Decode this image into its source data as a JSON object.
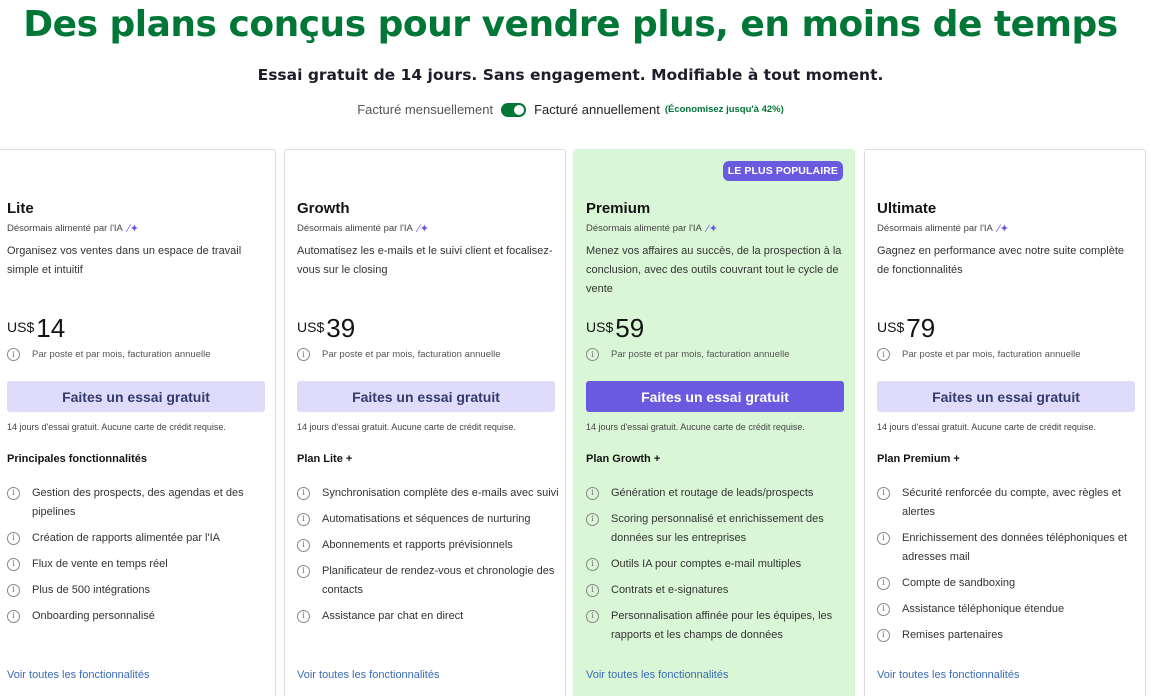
{
  "header": {
    "title": "Des plans conçus pour vendre plus, en moins de temps",
    "subtitle": "Essai gratuit de 14 jours. Sans engagement. Modifiable à tout moment."
  },
  "billing": {
    "monthly_label": "Facturé mensuellement",
    "annual_label": "Facturé annuellement",
    "savings": "(Économisez jusqu'à 42%)",
    "selected": "annual"
  },
  "plans": [
    {
      "name": "Lite",
      "ai_label": "Désormais alimenté par l'IA",
      "description": "Organisez vos ventes dans un espace de travail simple et intuitif",
      "currency": "US$",
      "price": "14",
      "price_note": "Par poste et par mois, facturation annuelle",
      "cta": "Faites un essai gratuit",
      "trial_note": "14 jours d'essai gratuit. Aucune carte de crédit requise.",
      "features_heading": "Principales fonctionnalités",
      "features": [
        "Gestion des prospects, des agendas et des pipelines",
        "Création de rapports alimentée par l'IA",
        "Flux de vente en temps réel",
        "Plus de 500 intégrations",
        "Onboarding personnalisé"
      ],
      "see_all": "Voir toutes les fonctionnalités"
    },
    {
      "name": "Growth",
      "ai_label": "Désormais alimenté par l'IA",
      "description": "Automatisez les e-mails et le suivi client et focalisez-vous sur le closing",
      "currency": "US$",
      "price": "39",
      "price_note": "Par poste et par mois, facturation annuelle",
      "cta": "Faites un essai gratuit",
      "trial_note": "14 jours d'essai gratuit. Aucune carte de crédit requise.",
      "features_heading": "Plan Lite +",
      "features": [
        "Synchronisation complète des e-mails avec suivi",
        "Automatisations et séquences de nurturing",
        "Abonnements et rapports prévisionnels",
        "Planificateur de rendez-vous et chronologie des contacts",
        "Assistance par chat en direct"
      ],
      "see_all": "Voir toutes les fonctionnalités"
    },
    {
      "name": "Premium",
      "badge": "LE PLUS POPULAIRE",
      "ai_label": "Désormais alimenté par l'IA",
      "description": "Menez vos affaires au succès, de la prospection à la conclusion, avec des outils couvrant tout le cycle de vente",
      "currency": "US$",
      "price": "59",
      "price_note": "Par poste et par mois, facturation annuelle",
      "cta": "Faites un essai gratuit",
      "trial_note": "14 jours d'essai gratuit. Aucune carte de crédit requise.",
      "features_heading": "Plan Growth +",
      "features": [
        "Génération et routage de leads/prospects",
        "Scoring personnalisé et enrichissement des données sur les entreprises",
        "Outils IA pour comptes e-mail multiples",
        "Contrats et e-signatures",
        "Personnalisation affinée pour les équipes, les rapports et les champs de données"
      ],
      "see_all": "Voir toutes les fonctionnalités"
    },
    {
      "name": "Ultimate",
      "ai_label": "Désormais alimenté par l'IA",
      "description": "Gagnez en performance avec notre suite complète de fonctionnalités",
      "currency": "US$",
      "price": "79",
      "price_note": "Par poste et par mois, facturation annuelle",
      "cta": "Faites un essai gratuit",
      "trial_note": "14 jours d'essai gratuit. Aucune carte de crédit requise.",
      "features_heading": "Plan Premium +",
      "features": [
        "Sécurité renforcée du compte, avec règles et alertes",
        "Enrichissement des données téléphoniques et adresses mail",
        "Compte de sandboxing",
        "Assistance téléphonique étendue",
        "Remises partenaires"
      ],
      "see_all": "Voir toutes les fonctionnalités"
    }
  ],
  "colors": {
    "brand_green": "#017737",
    "accent_purple": "#6a5ae0",
    "cta_light": "#dfdbfa",
    "premium_bg": "#d9f7d6",
    "link_blue": "#3a6bb5"
  }
}
